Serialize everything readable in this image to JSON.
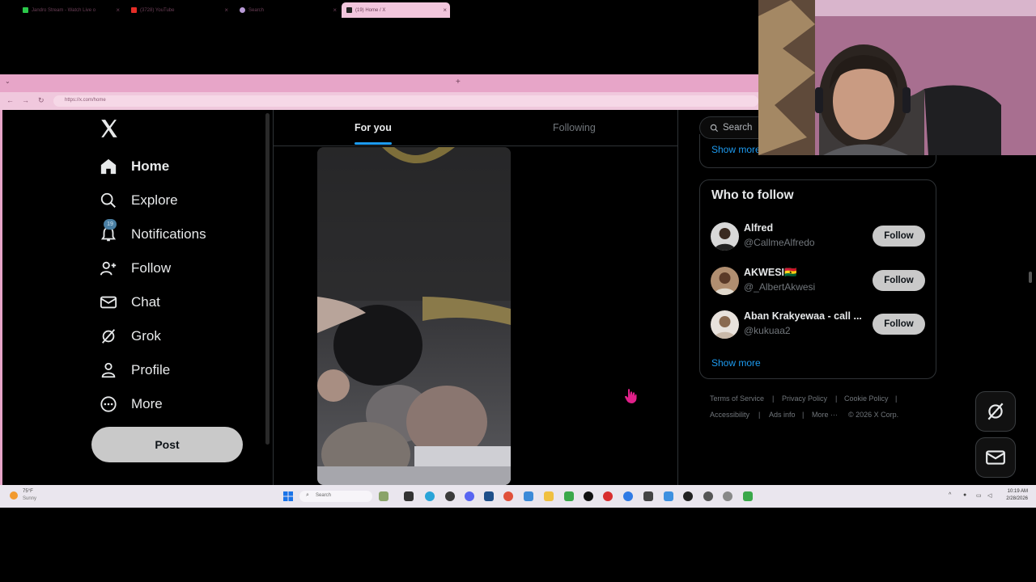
{
  "browser": {
    "tabs": [
      {
        "title": "Jandro Stream - Watch Live o",
        "favicon_color": "#2bc84a"
      },
      {
        "title": "(3728) YouTube",
        "favicon_color": "#e52d27"
      },
      {
        "title": "Search",
        "favicon_color": "#b99ad6"
      },
      {
        "title": "(19) Home / X",
        "favicon_color": "#222222"
      }
    ],
    "new_tab": "+",
    "url": "https://x.com/home"
  },
  "nav": {
    "items": [
      {
        "label": "Home",
        "icon": "home-icon"
      },
      {
        "label": "Explore",
        "icon": "search-icon"
      },
      {
        "label": "Notifications",
        "icon": "bell-icon"
      },
      {
        "label": "Follow",
        "icon": "person-add-icon"
      },
      {
        "label": "Chat",
        "icon": "envelope-icon"
      },
      {
        "label": "Grok",
        "icon": "grok-icon"
      },
      {
        "label": "Profile",
        "icon": "person-icon"
      },
      {
        "label": "More",
        "icon": "more-circle-icon"
      }
    ],
    "notifications_badge": "19",
    "post_label": "Post"
  },
  "feed": {
    "tabs": [
      "For you",
      "Following"
    ]
  },
  "sidebar": {
    "search_placeholder": "Search",
    "trends_show_more": "Show more",
    "who_to_follow": {
      "title": "Who to follow",
      "users": [
        {
          "name": "Alfred",
          "handle": "@CallmeAlfredo",
          "follow_label": "Follow"
        },
        {
          "name": "AKWESI🇬🇭",
          "handle": "@_AlbertAkwesi",
          "follow_label": "Follow"
        },
        {
          "name": "Aban Krakyewaa - call ...",
          "handle": "@kukuaa2",
          "follow_label": "Follow"
        }
      ],
      "show_more": "Show more"
    },
    "footer_links": [
      "Terms of Service",
      "Privacy Policy",
      "Cookie Policy",
      "Accessibility",
      "Ads info",
      "More ···",
      "© 2026 X Corp."
    ]
  },
  "taskbar": {
    "weather_temp": "75°F",
    "weather_desc": "Sunny",
    "search_placeholder": "Search",
    "time": "10:19 AM",
    "date": "2/28/2026"
  },
  "colors": {
    "accent": "#1d9bf0",
    "browser_chrome": "#e7a5c8",
    "button_bg": "#c9c9c9"
  }
}
